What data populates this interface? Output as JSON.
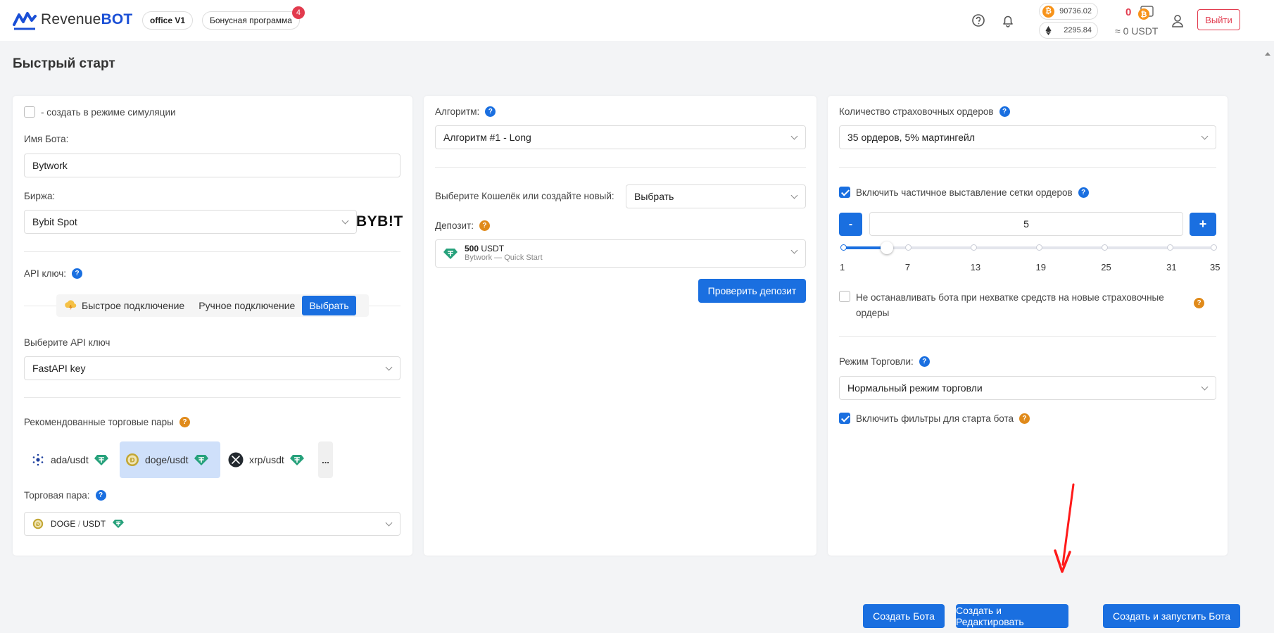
{
  "header": {
    "logo_text_1": "Revenue",
    "logo_text_2": "BOT",
    "office_pill": "office V1",
    "bonus_pill": "Бонусная программа",
    "bonus_badge": "4",
    "btc_price": "90736.02",
    "eth_price": "2295.84",
    "balance_count": "0",
    "balance_usdt": "≈ 0 USDT",
    "logout_label": "Выйти"
  },
  "page": {
    "title": "Быстрый старт"
  },
  "card1": {
    "simulation_label": "- создать в режиме симуляции",
    "bot_name_label": "Имя Бота:",
    "bot_name_value": "Bytwork",
    "exchange_label": "Биржа:",
    "exchange_value": "Bybit Spot",
    "exchange_logo": "BYB!T",
    "api_key_label": "API ключ:",
    "seg_fast": "Быстрое подключение",
    "seg_manual": "Ручное подключение",
    "seg_choose": "Выбрать",
    "api_select_label": "Выберите API ключ",
    "api_select_value": "FastAPI key",
    "pairs_label": "Рекомендованные торговые пары",
    "pairs": [
      {
        "name": "ada/usdt",
        "icon": "cardano-icon",
        "selected": false
      },
      {
        "name": "doge/usdt",
        "icon": "doge-icon",
        "selected": true
      },
      {
        "name": "xrp/usdt",
        "icon": "xrp-icon",
        "selected": false
      }
    ],
    "more_label": "...",
    "pair_label": "Торговая пара:",
    "pair_base": "DOGE",
    "pair_sep": "/",
    "pair_quote": "USDT"
  },
  "card2": {
    "algo_label": "Алгоритм:",
    "algo_value": "Алгоритм #1 - Long",
    "wallet_label": "Выберите Кошелёк или создайте новый:",
    "wallet_value": "Выбрать",
    "deposit_label": "Депозит:",
    "deposit_amount": "500",
    "deposit_currency": "USDT",
    "deposit_sub": "Bytwork — Quick Start",
    "check_deposit": "Проверить депозит"
  },
  "card3": {
    "safety_label": "Количество страховочных ордеров",
    "safety_value": "35 ордеров, 5% мартингейл",
    "partial_label": "Включить частичное выставление сетки ордеров",
    "minus": "-",
    "plus": "+",
    "grid_value": "5",
    "slider": {
      "min": 1,
      "max": 35,
      "value": 5,
      "ticks": [
        "1",
        "7",
        "13",
        "19",
        "25",
        "31",
        "35"
      ]
    },
    "no_stop_label_1": "Не останавливать бота при нехватке средств на новые страховочные",
    "no_stop_label_2": "ордеры",
    "mode_label": "Режим Торговли:",
    "mode_value": "Нормальный режим торговли",
    "filters_label": "Включить фильтры для старта бота"
  },
  "footer": {
    "create": "Создать Бота",
    "create_edit": "Создать и Редактировать",
    "create_start": "Создать и запустить Бота"
  },
  "colors": {
    "accent": "#1a6fe0",
    "danger": "#e23b4e",
    "annotation_arrow": "#ff1a1a"
  }
}
